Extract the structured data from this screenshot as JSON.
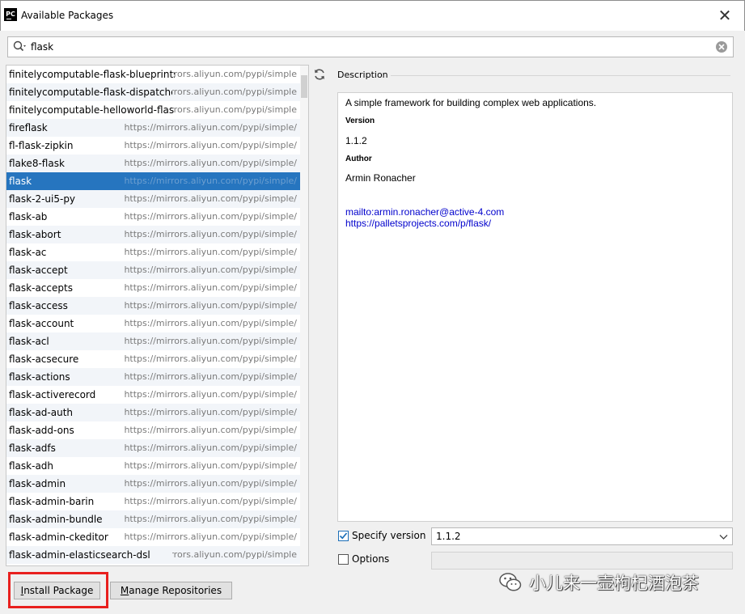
{
  "window": {
    "app_icon_text": "PC",
    "title": "Available Packages",
    "close_glyph": "✕"
  },
  "search": {
    "value": "flask",
    "icon": "search-icon",
    "clear_icon": "clear-icon"
  },
  "packages": [
    {
      "name": "finitelycomputable-flask-blueprints",
      "repo": "https://mirrors.aliyun.com/pypi/simple/"
    },
    {
      "name": "finitelycomputable-flask-dispatcher",
      "repo": "https://mirrors.aliyun.com/pypi/simple/"
    },
    {
      "name": "finitelycomputable-helloworld-flask",
      "repo": "https://mirrors.aliyun.com/pypi/simple/"
    },
    {
      "name": "fireflask",
      "repo": "https://mirrors.aliyun.com/pypi/simple/"
    },
    {
      "name": "fl-flask-zipkin",
      "repo": "https://mirrors.aliyun.com/pypi/simple/"
    },
    {
      "name": "flake8-flask",
      "repo": "https://mirrors.aliyun.com/pypi/simple/"
    },
    {
      "name": "flask",
      "repo": "https://mirrors.aliyun.com/pypi/simple/",
      "selected": true
    },
    {
      "name": "flask-2-ui5-py",
      "repo": "https://mirrors.aliyun.com/pypi/simple/"
    },
    {
      "name": "flask-ab",
      "repo": "https://mirrors.aliyun.com/pypi/simple/"
    },
    {
      "name": "flask-abort",
      "repo": "https://mirrors.aliyun.com/pypi/simple/"
    },
    {
      "name": "flask-ac",
      "repo": "https://mirrors.aliyun.com/pypi/simple/"
    },
    {
      "name": "flask-accept",
      "repo": "https://mirrors.aliyun.com/pypi/simple/"
    },
    {
      "name": "flask-accepts",
      "repo": "https://mirrors.aliyun.com/pypi/simple/"
    },
    {
      "name": "flask-access",
      "repo": "https://mirrors.aliyun.com/pypi/simple/"
    },
    {
      "name": "flask-account",
      "repo": "https://mirrors.aliyun.com/pypi/simple/"
    },
    {
      "name": "flask-acl",
      "repo": "https://mirrors.aliyun.com/pypi/simple/"
    },
    {
      "name": "flask-acsecure",
      "repo": "https://mirrors.aliyun.com/pypi/simple/"
    },
    {
      "name": "flask-actions",
      "repo": "https://mirrors.aliyun.com/pypi/simple/"
    },
    {
      "name": "flask-activerecord",
      "repo": "https://mirrors.aliyun.com/pypi/simple/"
    },
    {
      "name": "flask-ad-auth",
      "repo": "https://mirrors.aliyun.com/pypi/simple/"
    },
    {
      "name": "flask-add-ons",
      "repo": "https://mirrors.aliyun.com/pypi/simple/"
    },
    {
      "name": "flask-adfs",
      "repo": "https://mirrors.aliyun.com/pypi/simple/"
    },
    {
      "name": "flask-adh",
      "repo": "https://mirrors.aliyun.com/pypi/simple/"
    },
    {
      "name": "flask-admin",
      "repo": "https://mirrors.aliyun.com/pypi/simple/"
    },
    {
      "name": "flask-admin-barin",
      "repo": "https://mirrors.aliyun.com/pypi/simple/"
    },
    {
      "name": "flask-admin-bundle",
      "repo": "https://mirrors.aliyun.com/pypi/simple/"
    },
    {
      "name": "flask-admin-ckeditor",
      "repo": "https://mirrors.aliyun.com/pypi/simple/"
    },
    {
      "name": "flask-admin-elasticsearch-dsl",
      "repo": "https://mirrors.aliyun.com/pypi/simple/"
    }
  ],
  "description": {
    "header": "Description",
    "summary": "A simple framework for building complex web applications.",
    "version_label": "Version",
    "version_value": "1.1.2",
    "author_label": "Author",
    "author_value": "Armin Ronacher",
    "link_email": "mailto:armin.ronacher@active-4.com",
    "link_home": "https://palletsprojects.com/p/flask/"
  },
  "options": {
    "specify_version_label": "Specify version",
    "specify_version_checked": true,
    "version_selected": "1.1.2",
    "options_label": "Options",
    "options_checked": false,
    "options_value": ""
  },
  "buttons": {
    "install_first": "I",
    "install_rest": "nstall Package",
    "manage_first": "M",
    "manage_rest": "anage Repositories"
  },
  "watermark": {
    "text": "小儿来一壶枸杞酒泡茶"
  },
  "colors": {
    "selection": "#2675bf",
    "link": "#0000cc",
    "highlight": "#e8201e"
  }
}
